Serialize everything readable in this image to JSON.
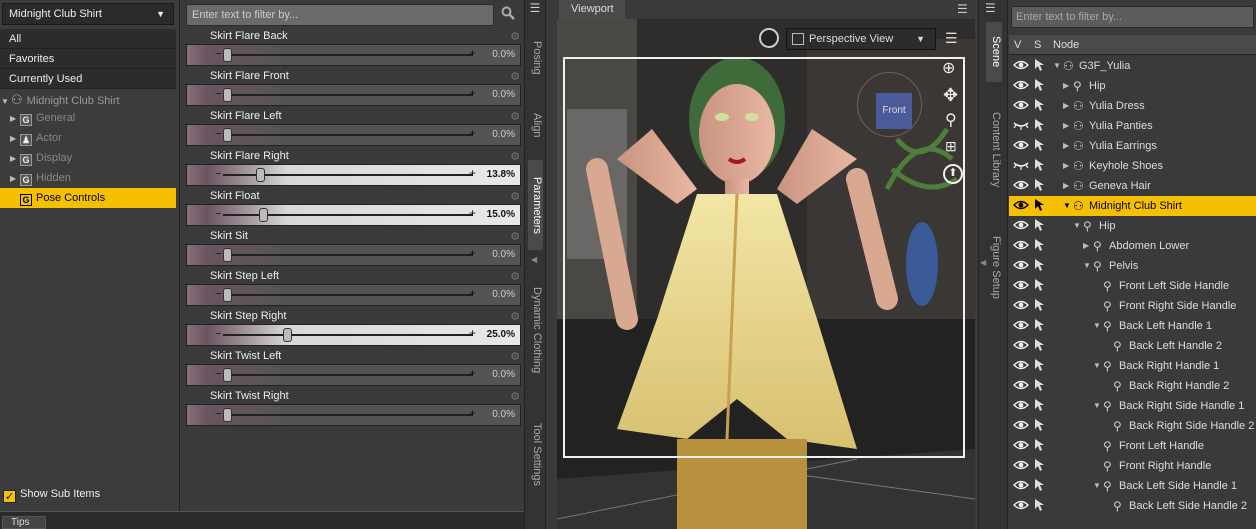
{
  "left_panel": {
    "figure_select": "Midnight Club Shirt",
    "categories": [
      "All",
      "Favorites",
      "Currently Used"
    ],
    "tree": [
      {
        "label": "Midnight Club Shirt",
        "level": 0,
        "type": "figure"
      },
      {
        "label": "General",
        "level": 1,
        "type": "group"
      },
      {
        "label": "Actor",
        "level": 1,
        "type": "actor"
      },
      {
        "label": "Display",
        "level": 1,
        "type": "group"
      },
      {
        "label": "Hidden",
        "level": 1,
        "type": "group"
      },
      {
        "label": "Pose Controls",
        "level": 1,
        "type": "group",
        "selected": true
      }
    ],
    "show_sub_items": "Show Sub Items",
    "tips_tab": "Tips"
  },
  "parameters": {
    "filter_placeholder": "Enter text to filter by...",
    "sliders": [
      {
        "name": "Skirt Flare Back",
        "value": "0.0%",
        "fraction": 0.0,
        "active": false
      },
      {
        "name": "Skirt Flare Front",
        "value": "0.0%",
        "fraction": 0.0,
        "active": false
      },
      {
        "name": "Skirt Flare Left",
        "value": "0.0%",
        "fraction": 0.0,
        "active": false
      },
      {
        "name": "Skirt Flare Right",
        "value": "13.8%",
        "fraction": 0.138,
        "active": true
      },
      {
        "name": "Skirt Float",
        "value": "15.0%",
        "fraction": 0.15,
        "active": true
      },
      {
        "name": "Skirt Sit",
        "value": "0.0%",
        "fraction": 0.0,
        "active": false
      },
      {
        "name": "Skirt Step Left",
        "value": "0.0%",
        "fraction": 0.0,
        "active": false
      },
      {
        "name": "Skirt Step Right",
        "value": "25.0%",
        "fraction": 0.25,
        "active": true
      },
      {
        "name": "Skirt Twist Left",
        "value": "0.0%",
        "fraction": 0.0,
        "active": false
      },
      {
        "name": "Skirt Twist Right",
        "value": "0.0%",
        "fraction": 0.0,
        "active": false
      }
    ]
  },
  "side_tabs": {
    "middle": [
      "Posing",
      "Align",
      "Parameters",
      "Dynamic Clothing",
      "Tool Settings"
    ],
    "active_middle": "Parameters",
    "right": [
      "Scene",
      "Content Library",
      "Figure Setup"
    ],
    "active_right": "Scene"
  },
  "viewport": {
    "tab": "Viewport",
    "camera": "Perspective View",
    "view_cube_label": "Front"
  },
  "scene": {
    "filter_placeholder": "Enter text to filter by...",
    "columns": [
      "V",
      "S",
      "Node"
    ],
    "nodes": [
      {
        "label": "G3F_Yulia",
        "level": 0,
        "expanded": true,
        "icon": "figure-icon"
      },
      {
        "label": "Hip",
        "level": 1,
        "expanded": false,
        "icon": "bone-icon"
      },
      {
        "label": "Yulia Dress",
        "level": 1,
        "expanded": false,
        "icon": "figure-icon"
      },
      {
        "label": "Yulia Panties",
        "level": 1,
        "expanded": false,
        "icon": "figure-icon",
        "hidden": true
      },
      {
        "label": "Yulia Earrings",
        "level": 1,
        "expanded": false,
        "icon": "figure-icon"
      },
      {
        "label": "Keyhole Shoes",
        "level": 1,
        "expanded": false,
        "icon": "figure-icon",
        "hidden": true
      },
      {
        "label": "Geneva Hair",
        "level": 1,
        "expanded": false,
        "icon": "figure-icon"
      },
      {
        "label": "Midnight Club Shirt",
        "level": 1,
        "expanded": true,
        "icon": "figure-icon",
        "selected": true
      },
      {
        "label": "Hip",
        "level": 2,
        "expanded": true,
        "icon": "bone-icon"
      },
      {
        "label": "Abdomen Lower",
        "level": 3,
        "expanded": false,
        "icon": "bone-icon"
      },
      {
        "label": "Pelvis",
        "level": 3,
        "expanded": true,
        "icon": "bone-icon"
      },
      {
        "label": "Front Left Side Handle",
        "level": 4,
        "icon": "bone-icon"
      },
      {
        "label": "Front Right Side Handle",
        "level": 4,
        "icon": "bone-icon"
      },
      {
        "label": "Back Left Handle 1",
        "level": 4,
        "expanded": true,
        "icon": "bone-icon"
      },
      {
        "label": "Back Left Handle 2",
        "level": 5,
        "icon": "bone-icon"
      },
      {
        "label": "Back Right Handle 1",
        "level": 4,
        "expanded": true,
        "icon": "bone-icon"
      },
      {
        "label": "Back Right Handle 2",
        "level": 5,
        "icon": "bone-icon"
      },
      {
        "label": "Back Right Side Handle 1",
        "level": 4,
        "expanded": true,
        "icon": "bone-icon"
      },
      {
        "label": "Back Right Side Handle 2",
        "level": 5,
        "icon": "bone-icon"
      },
      {
        "label": "Front Left Handle",
        "level": 4,
        "icon": "bone-icon"
      },
      {
        "label": "Front Right Handle",
        "level": 4,
        "icon": "bone-icon"
      },
      {
        "label": "Back Left Side Handle 1",
        "level": 4,
        "expanded": true,
        "icon": "bone-icon"
      },
      {
        "label": "Back Left Side Handle 2",
        "level": 5,
        "icon": "bone-icon"
      }
    ]
  },
  "colors": {
    "selection": "#f5c000",
    "panel_bg": "#3a3a3a",
    "dark_bg": "#2c2c2c"
  }
}
